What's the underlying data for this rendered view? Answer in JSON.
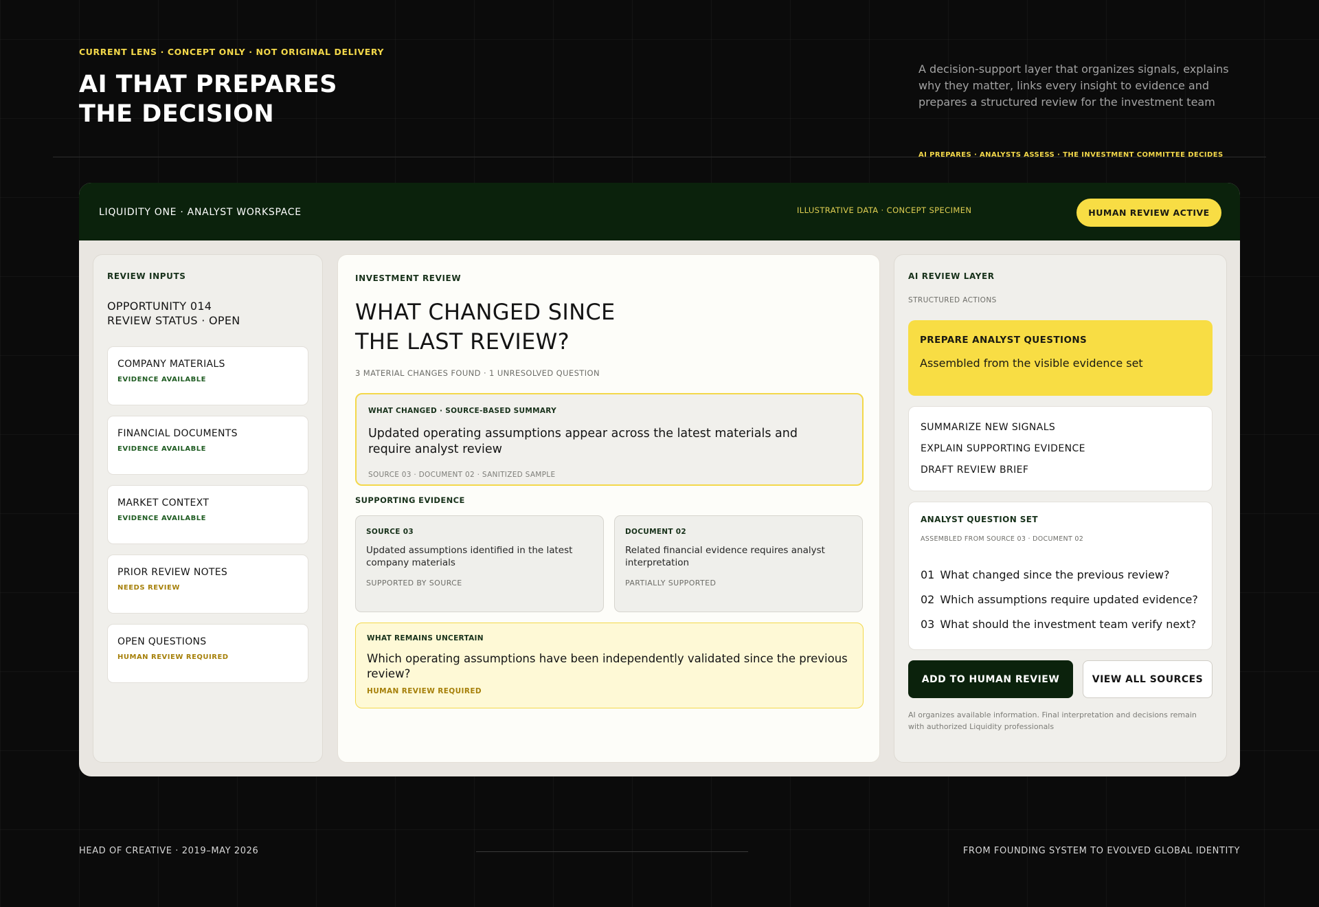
{
  "hero": {
    "kicker": "CURRENT LENS · CONCEPT ONLY · NOT ORIGINAL DELIVERY",
    "title_line1": "AI THAT PREPARES",
    "title_line2": "THE DECISION",
    "description": "A decision-support layer that organizes signals, explains why they matter, links every insight to evidence and prepares a structured review for the investment team",
    "tagline": "AI PREPARES · ANALYSTS ASSESS · THE INVESTMENT COMMITTEE DECIDES"
  },
  "workspace": {
    "title": "LIQUIDITY ONE · ANALYST WORKSPACE",
    "note": "ILLUSTRATIVE DATA · CONCEPT SPECIMEN",
    "badge": "HUMAN REVIEW ACTIVE",
    "inputs": {
      "eyebrow": "REVIEW INPUTS",
      "opportunity": "OPPORTUNITY 014",
      "status": "REVIEW STATUS · OPEN",
      "items": [
        {
          "name": "COMPANY MATERIALS",
          "status": "EVIDENCE AVAILABLE"
        },
        {
          "name": "FINANCIAL DOCUMENTS",
          "status": "EVIDENCE AVAILABLE"
        },
        {
          "name": "MARKET CONTEXT",
          "status": "EVIDENCE AVAILABLE"
        },
        {
          "name": "PRIOR REVIEW NOTES",
          "status": "NEEDS REVIEW"
        },
        {
          "name": "OPEN QUESTIONS",
          "status": "HUMAN REVIEW REQUIRED"
        }
      ]
    },
    "review": {
      "eyebrow": "INVESTMENT REVIEW",
      "title_line1": "WHAT CHANGED SINCE",
      "title_line2": "THE LAST REVIEW?",
      "meta": "3 MATERIAL CHANGES FOUND · 1 UNRESOLVED QUESTION",
      "summary": {
        "eyebrow": "WHAT CHANGED · SOURCE-BASED SUMMARY",
        "text": "Updated operating assumptions appear across the latest materials and require analyst review",
        "source": "SOURCE 03 · DOCUMENT 02 · SANITIZED SAMPLE"
      },
      "supporting_label": "SUPPORTING EVIDENCE",
      "evidence": [
        {
          "name": "SOURCE 03",
          "text": "Updated assumptions identified in the latest company materials",
          "status": "SUPPORTED BY SOURCE"
        },
        {
          "name": "DOCUMENT 02",
          "text": "Related financial evidence requires analyst interpretation",
          "status": "PARTIALLY SUPPORTED"
        }
      ],
      "uncertain": {
        "eyebrow": "WHAT REMAINS UNCERTAIN",
        "text": "Which operating assumptions have been independently validated since the previous review?",
        "status": "HUMAN REVIEW REQUIRED"
      }
    },
    "ai_layer": {
      "eyebrow": "AI REVIEW LAYER",
      "subtitle": "STRUCTURED ACTIONS",
      "primary_action": {
        "title": "PREPARE ANALYST QUESTIONS",
        "description": "Assembled from the visible evidence set"
      },
      "actions": [
        "SUMMARIZE NEW SIGNALS",
        "EXPLAIN SUPPORTING EVIDENCE",
        "DRAFT REVIEW BRIEF"
      ],
      "question_set": {
        "title": "ANALYST QUESTION SET",
        "subtitle": "ASSEMBLED FROM SOURCE 03 · DOCUMENT 02",
        "questions": [
          {
            "num": "01",
            "text": "What changed since the previous review?"
          },
          {
            "num": "02",
            "text": "Which assumptions require updated evidence?"
          },
          {
            "num": "03",
            "text": "What should the investment team verify next?"
          }
        ]
      },
      "add_button": "ADD TO HUMAN REVIEW",
      "view_button": "VIEW ALL SOURCES",
      "disclaimer": "AI organizes available information. Final interpretation and decisions remain with authorized Liquidity professionals"
    }
  },
  "footer": {
    "left": "HEAD OF CREATIVE · 2019–MAY 2026",
    "right": "FROM FOUNDING SYSTEM TO EVOLVED GLOBAL IDENTITY"
  },
  "colors": {
    "accent_yellow": "#f8dd44",
    "dark_green": "#0b220c",
    "background": "#0b0b0b"
  }
}
